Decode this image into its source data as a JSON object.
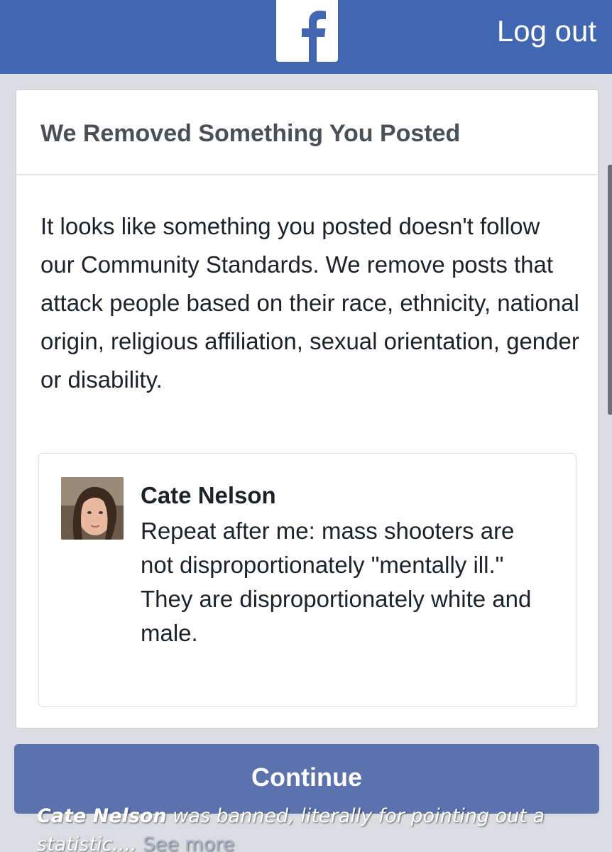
{
  "topbar": {
    "logo_icon": "facebook-f-logo",
    "logout_label": "Log out",
    "color": "#4267b2"
  },
  "notice": {
    "title": "We Removed Something You Posted",
    "message": "It looks like something you posted doesn't follow our Community Standards. We remove posts that attack people based on their race, ethnicity, national origin, religious affiliation, sexual orientation, gender or disability."
  },
  "post": {
    "author": "Cate Nelson",
    "text": "Repeat after me: mass shooters are not disproportionately \"mentally ill.\" They are disproportionately white and male.",
    "avatar_icon": "profile-photo"
  },
  "continue_label": "Continue",
  "caption": {
    "name": "Cate Nelson",
    "text": " was banned, literally for pointing out a statistic....",
    "see_more": " See more"
  }
}
